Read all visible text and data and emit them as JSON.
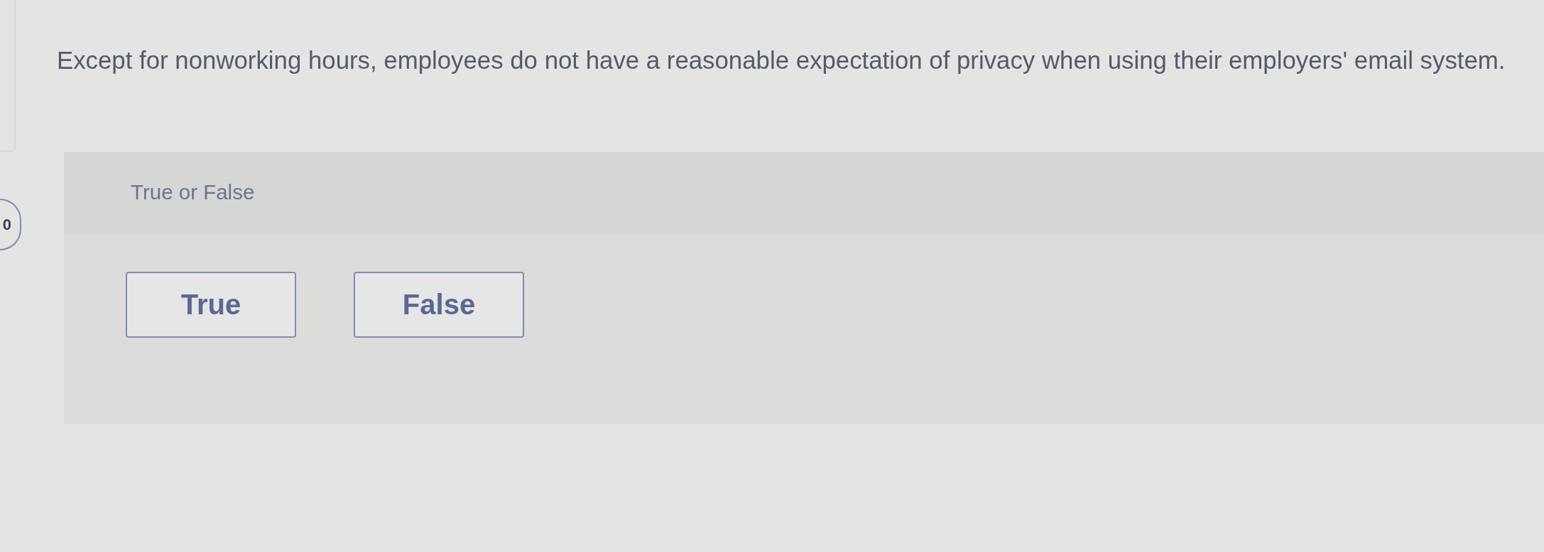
{
  "question": {
    "text": "Except for nonworking hours, employees do not have a reasonable expectation of privacy when using their employers' email system."
  },
  "side_badge": {
    "text": "0"
  },
  "answer_panel": {
    "prompt": "True or False",
    "choices": [
      {
        "label": "True",
        "selected": false
      },
      {
        "label": "False",
        "selected": false
      }
    ]
  }
}
